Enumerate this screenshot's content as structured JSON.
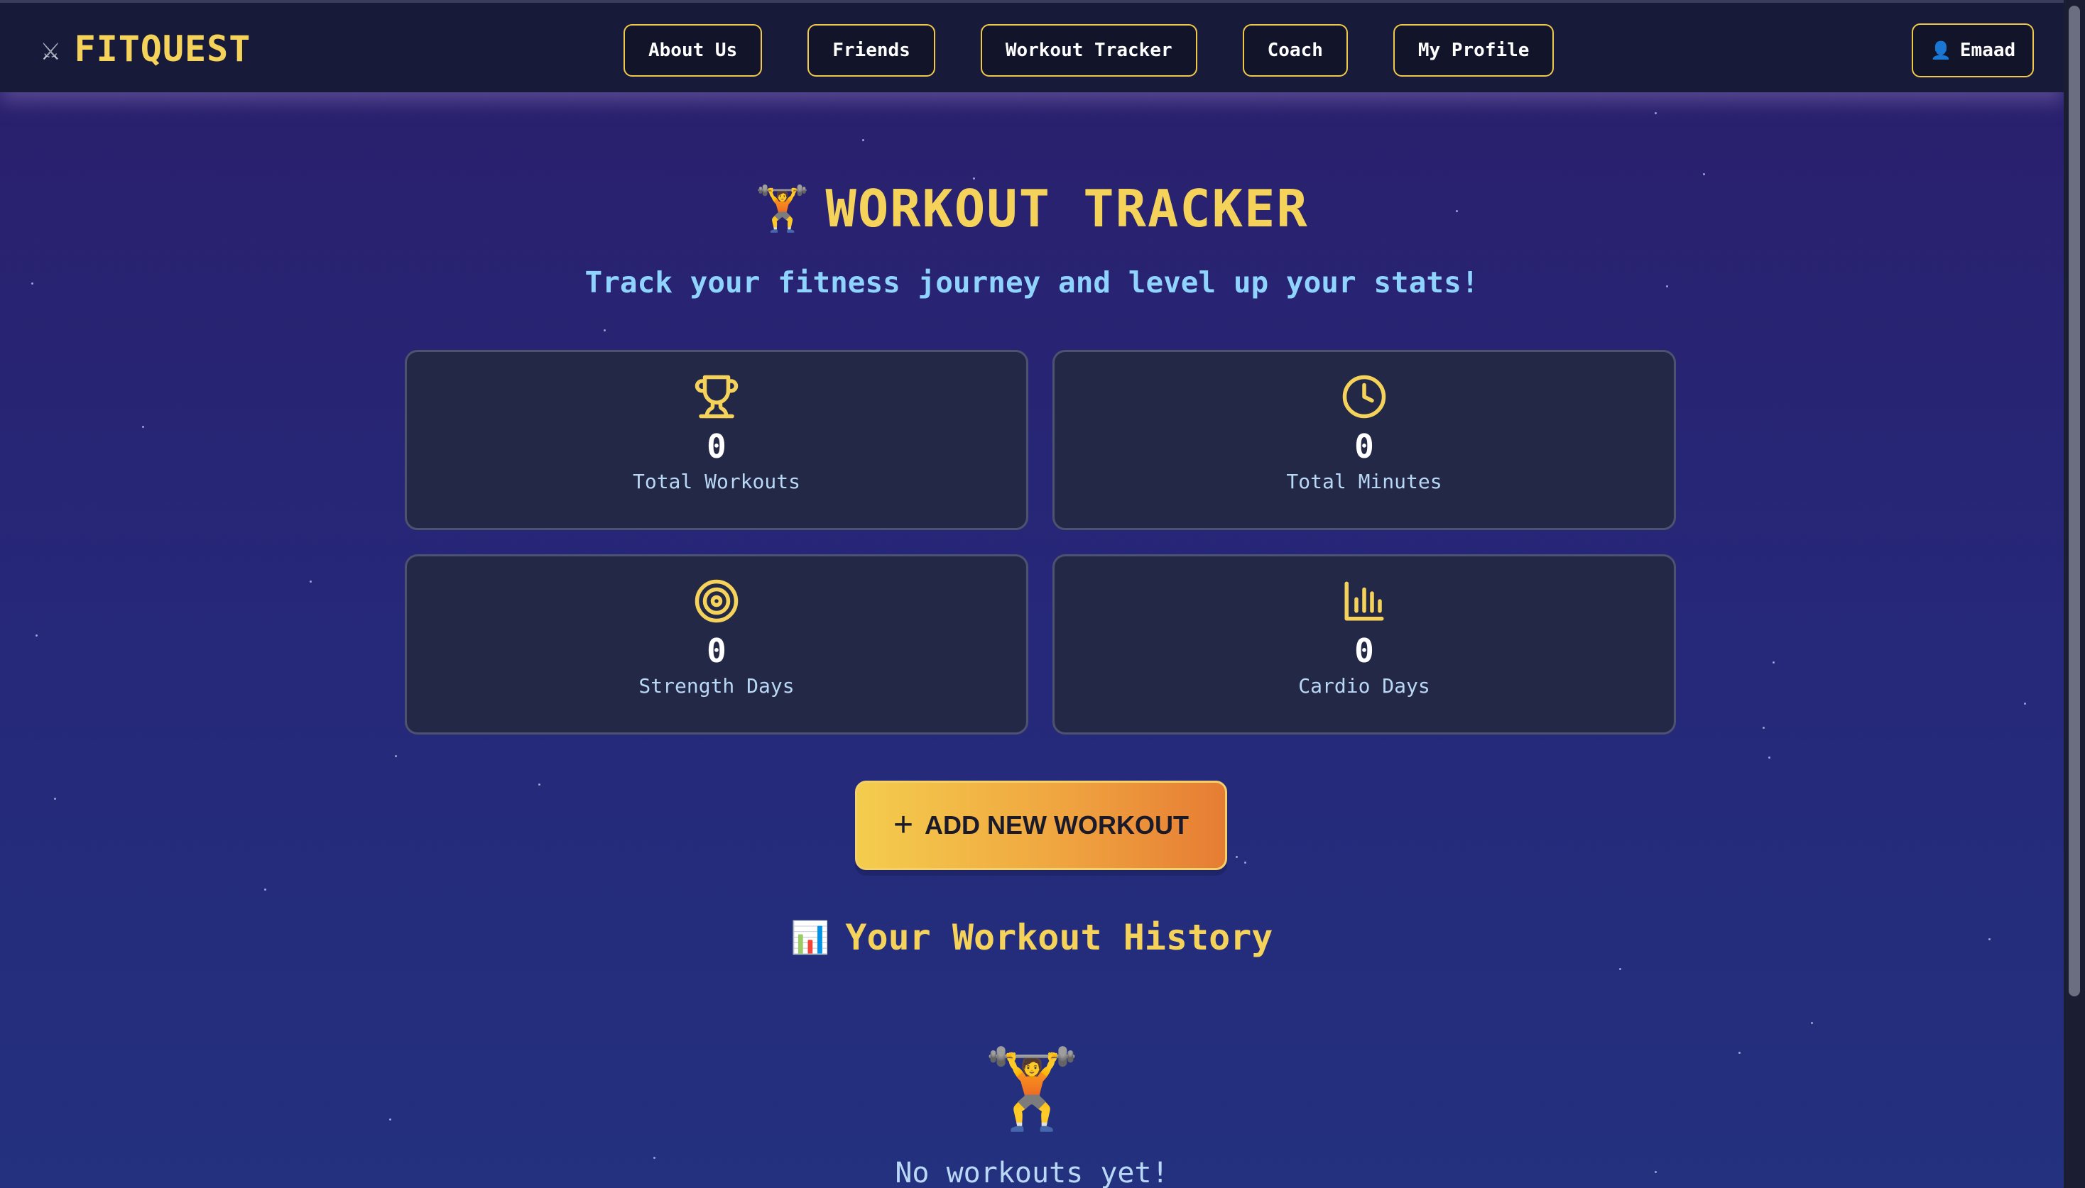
{
  "brand": {
    "icon": "crossed-swords-icon",
    "glyph": "⚔",
    "name": "FITQUEST"
  },
  "nav": {
    "items": [
      {
        "label": "About Us"
      },
      {
        "label": "Friends"
      },
      {
        "label": "Workout Tracker"
      },
      {
        "label": "Coach"
      },
      {
        "label": "My Profile"
      }
    ],
    "user": {
      "icon": "user-icon",
      "glyph": "👤",
      "name": "Emaad"
    }
  },
  "header": {
    "emoji": "🏋️",
    "title": "WORKOUT TRACKER",
    "subtitle": "Track your fitness journey and level up your stats!"
  },
  "stats": [
    {
      "icon": "trophy-icon",
      "value": "0",
      "label": "Total Workouts"
    },
    {
      "icon": "clock-icon",
      "value": "0",
      "label": "Total Minutes"
    },
    {
      "icon": "target-icon",
      "value": "0",
      "label": "Strength Days"
    },
    {
      "icon": "bar-chart-icon",
      "value": "0",
      "label": "Cardio Days"
    }
  ],
  "add_button": {
    "icon": "plus-icon",
    "glyph": "+",
    "label": "ADD NEW WORKOUT"
  },
  "history": {
    "emoji": "📊",
    "title": "Your Workout History",
    "empty_emoji": "🏋️",
    "empty_text": "No workouts yet!"
  },
  "colors": {
    "accent": "#f5d35a",
    "subtitle": "#8fd3ff",
    "card_bg": "#232847",
    "nav_bg": "#181a3a",
    "button_gradient_start": "#f4cd4d",
    "button_gradient_end": "#e67c34"
  }
}
